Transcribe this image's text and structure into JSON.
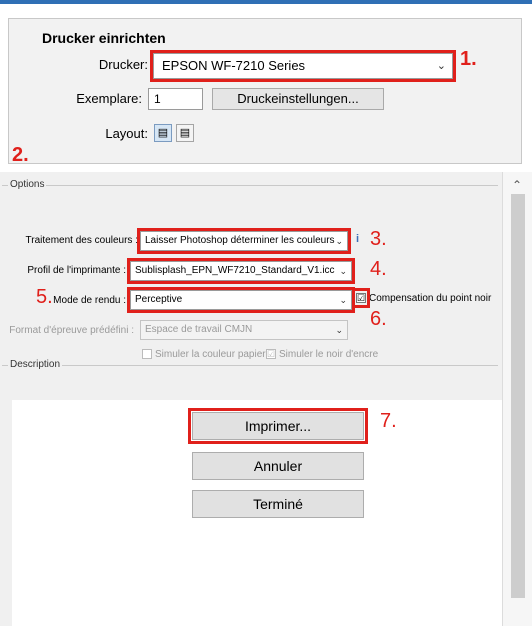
{
  "printer": {
    "title": "Drucker einrichten",
    "printer_label": "Drucker:",
    "printer_value": "EPSON WF-7210 Series",
    "copies_label": "Exemplare:",
    "copies_value": "1",
    "settings_button": "Druckeinstellungen...",
    "layout_label": "Layout:",
    "layout_portrait_icon": "portrait-layout-icon",
    "layout_landscape_icon": "landscape-layout-icon"
  },
  "options": {
    "legend": "Options",
    "color_handling_label": "Traitement des couleurs :",
    "color_handling_value": "Laisser Photoshop déterminer les couleurs",
    "printer_profile_label": "Profil de l'imprimante :",
    "printer_profile_value": "Sublisplash_EPN_WF7210_Standard_V1.icc",
    "render_mode_label": "Mode de rendu :",
    "render_mode_value": "Perceptive",
    "black_point_label": "Compensation du point noir",
    "black_point_checked": "☑",
    "proof_preset_label": "Format d'épreuve prédéfini :",
    "proof_preset_value": "Espace de travail CMJN",
    "sim_paper_label": "Simuler la couleur papier",
    "sim_ink_label": "Simuler le noir d'encre",
    "sim_ink_checked": "☑"
  },
  "description": {
    "legend": "Description"
  },
  "actions": {
    "print": "Imprimer...",
    "cancel": "Annuler",
    "done": "Terminé"
  },
  "annotations": {
    "n1": "1.",
    "n2": "2.",
    "n3": "3.",
    "n4": "4.",
    "n5": "5.",
    "n6": "6.",
    "n7": "7."
  },
  "colors": {
    "annotation_red": "#e0201b",
    "accent_blue": "#2f6fb5"
  }
}
